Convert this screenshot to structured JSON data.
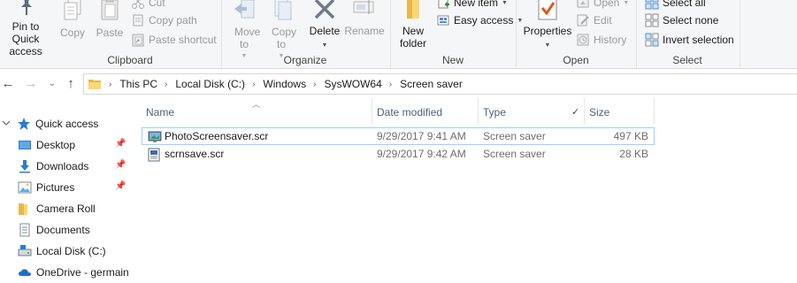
{
  "ribbon": {
    "clipboard": {
      "label": "Clipboard",
      "pin": "Pin to Quick access",
      "copy": "Copy",
      "paste": "Paste",
      "cut": "Cut",
      "copy_path": "Copy path",
      "paste_shortcut": "Paste shortcut"
    },
    "organize": {
      "label": "Organize",
      "move_to": "Move to",
      "copy_to": "Copy to",
      "delete": "Delete",
      "rename": "Rename"
    },
    "new": {
      "label": "New",
      "new_folder": "New folder",
      "new_item": "New item",
      "easy_access": "Easy access"
    },
    "open": {
      "label": "Open",
      "properties": "Properties",
      "open": "Open",
      "edit": "Edit",
      "history": "History"
    },
    "select": {
      "label": "Select",
      "select_all": "Select all",
      "select_none": "Select none",
      "invert_selection": "Invert selection"
    }
  },
  "address": {
    "crumbs": [
      "This PC",
      "Local Disk (C:)",
      "Windows",
      "SysWOW64",
      "Screen saver"
    ]
  },
  "nav": {
    "items": [
      {
        "label": "Quick access",
        "icon": "star-icon",
        "pinned": false
      },
      {
        "label": "Desktop",
        "icon": "desktop-folder-icon",
        "pinned": true
      },
      {
        "label": "Downloads",
        "icon": "downloads-icon",
        "pinned": true
      },
      {
        "label": "Pictures",
        "icon": "pictures-icon",
        "pinned": true
      },
      {
        "label": "Camera Roll",
        "icon": "folder-icon",
        "pinned": false
      },
      {
        "label": "Documents",
        "icon": "documents-icon",
        "pinned": false
      },
      {
        "label": "Local Disk (C:)",
        "icon": "drive-icon",
        "pinned": false
      },
      {
        "label": "OneDrive - germain",
        "icon": "cloud-icon",
        "pinned": false
      }
    ]
  },
  "files": {
    "columns": {
      "name": "Name",
      "date": "Date modified",
      "type": "Type",
      "size": "Size"
    },
    "rows": [
      {
        "name": "PhotoScreensaver.scr",
        "date": "9/29/2017 9:41 AM",
        "type": "Screen saver",
        "size": "497 KB"
      },
      {
        "name": "scrnsave.scr",
        "date": "9/29/2017 9:42 AM",
        "type": "Screen saver",
        "size": "28 KB"
      }
    ]
  },
  "colors": {
    "accent": "#0078d7",
    "selection_border": "#99d1ff",
    "header_text": "#4c607a"
  }
}
